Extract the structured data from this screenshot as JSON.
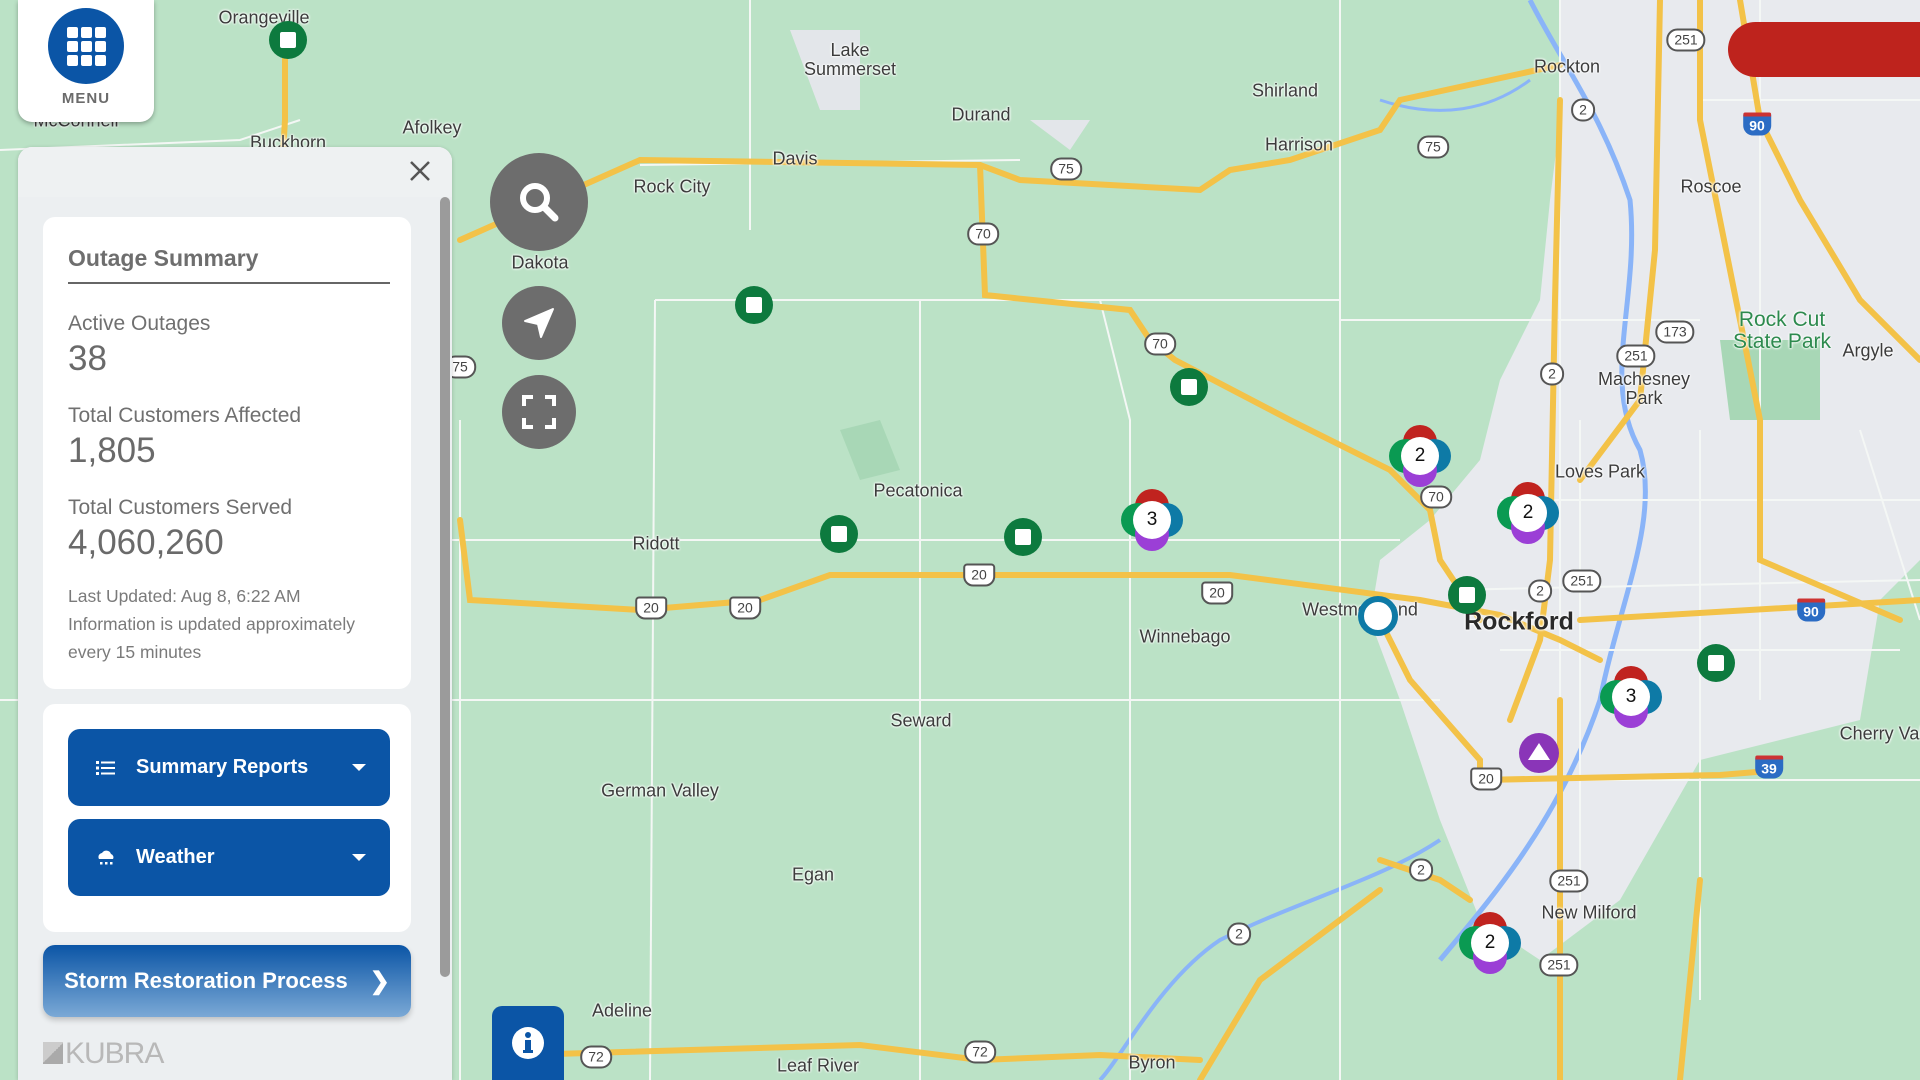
{
  "menu": {
    "label": "MENU",
    "icon": "grid-menu-icon"
  },
  "panel": {
    "close_icon": "close-icon",
    "summary": {
      "title": "Outage Summary",
      "active_outages_label": "Active Outages",
      "active_outages": "38",
      "customers_affected_label": "Total Customers Affected",
      "customers_affected": "1,805",
      "customers_served_label": "Total Customers Served",
      "customers_served": "4,060,260",
      "last_updated": "Last Updated:  Aug 8, 6:22 AM",
      "update_note": "Information is updated approximately every 15 minutes"
    },
    "dropdowns": [
      {
        "label": "Summary Reports",
        "icon": "list-icon"
      },
      {
        "label": "Weather",
        "icon": "weather-cloud-icon"
      }
    ],
    "storm_button": {
      "label": "Storm Restoration Process",
      "icon": "chevron-right-icon"
    },
    "brand": "KUBRA"
  },
  "map_controls": {
    "search_icon": "search-icon",
    "locate_icon": "navigation-arrow-icon",
    "fullscreen_icon": "fullscreen-icon",
    "info_icon": "info-icon"
  },
  "colors": {
    "brand_blue": "#0b55a6",
    "alert_red": "#be231d",
    "outage_green": "#0d7a3e",
    "cluster_red": "#c0231f",
    "cluster_green": "#0a9a52",
    "cluster_blue": "#0e7aa6",
    "cluster_purple": "#9b3fd6",
    "map_land": "#bbe2c6"
  },
  "map": {
    "places": [
      {
        "name": "Orangeville"
      },
      {
        "name": "McConnell"
      },
      {
        "name": "Buckhorn"
      },
      {
        "name": "Afolkey"
      },
      {
        "name": "Lake Summerset"
      },
      {
        "name": "Durand"
      },
      {
        "name": "Shirland"
      },
      {
        "name": "Rockton"
      },
      {
        "name": "Harrison"
      },
      {
        "name": "Davis"
      },
      {
        "name": "Rock City"
      },
      {
        "name": "Dakota"
      },
      {
        "name": "Roscoe"
      },
      {
        "name": "Rock Cut State Park"
      },
      {
        "name": "Argyle"
      },
      {
        "name": "Machesney Park"
      },
      {
        "name": "Loves Park"
      },
      {
        "name": "Pecatonica"
      },
      {
        "name": "Ridott"
      },
      {
        "name": "Winnebago"
      },
      {
        "name": "Westmoreland"
      },
      {
        "name": "Rockford"
      },
      {
        "name": "Cherry Valley"
      },
      {
        "name": "Seward"
      },
      {
        "name": "German Valley"
      },
      {
        "name": "Egan"
      },
      {
        "name": "New Milford"
      },
      {
        "name": "Adeline"
      },
      {
        "name": "Leaf River"
      },
      {
        "name": "Byron"
      }
    ],
    "shields": [
      "251",
      "2",
      "90",
      "75",
      "70",
      "75",
      "173",
      "251",
      "2",
      "70",
      "70",
      "20",
      "20",
      "20",
      "20",
      "2",
      "251",
      "90",
      "39",
      "20",
      "251",
      "2",
      "2",
      "251",
      "72",
      "72",
      "75"
    ],
    "clusters": [
      {
        "count": "2"
      },
      {
        "count": "2"
      },
      {
        "count": "3"
      },
      {
        "count": "3"
      },
      {
        "count": "2"
      }
    ]
  }
}
